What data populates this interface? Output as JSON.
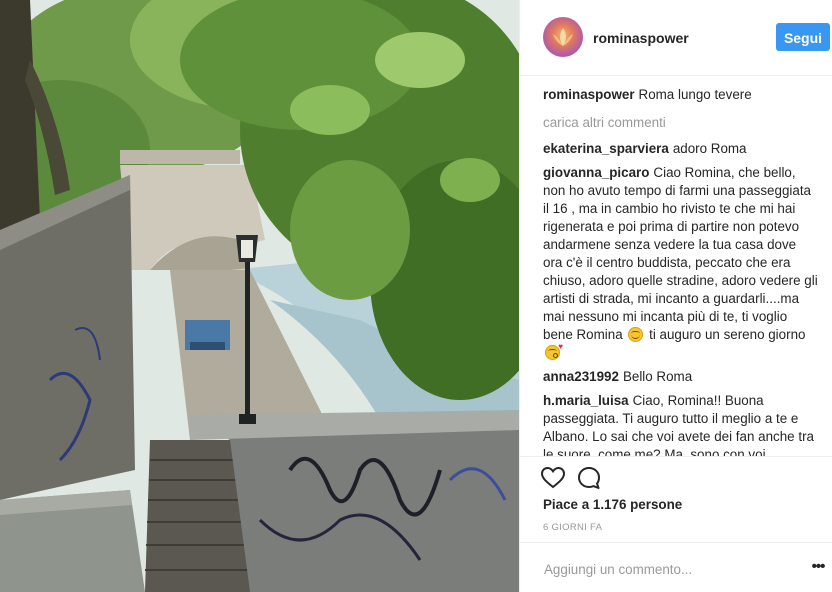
{
  "post": {
    "author": "rominaspower",
    "follow_label": "Segui",
    "caption": {
      "user": "rominaspower",
      "text": "Roma lungo tevere"
    },
    "load_more_label": "carica altri commenti",
    "comments": [
      {
        "user": "ekaterina_sparviera",
        "text": "adoro Roma"
      },
      {
        "user": "giovanna_picaro",
        "text": "Ciao Romina, che bello, non ho avuto tempo di farmi una passeggiata il 16 , ma in cambio ho rivisto te che mi hai rigenerata e poi prima di partire non potevo andarmene senza vedere la tua casa dove ora c'è il centro buddista, peccato che era chiuso, adoro quelle stradine, adoro vedere gli artisti di strada, mi incanto a guardarli....ma mai nessuno mi incanta più di te, ti voglio bene Romina",
        "text_after_emoji": "ti auguro un sereno giorno"
      },
      {
        "user": "anna231992",
        "text": "Bello Roma"
      },
      {
        "user": "h.maria_luisa",
        "text": "Ciao, Romina!! Buona passeggiata. Ti auguro tutto il meglio a te e Albano. Lo sai che voi avete dei fan anche tra le suore, come me? Ma, sono con voi"
      }
    ],
    "likes_label": "Piace a 1.176 persone",
    "date_label": "6 GIORNI FA",
    "add_comment_placeholder": "Aggiungi un commento...",
    "more_options_glyph": "•••"
  },
  "icons": {
    "like": "heart-icon",
    "comment": "comment-bubble-icon",
    "more": "more-options-icon",
    "emoji_smile": "smiling-face-emoji",
    "emoji_kiss": "face-blowing-kiss-emoji"
  },
  "colors": {
    "accent": "#3897f0",
    "text": "#262626",
    "muted": "#999999",
    "divider": "#efefef"
  }
}
